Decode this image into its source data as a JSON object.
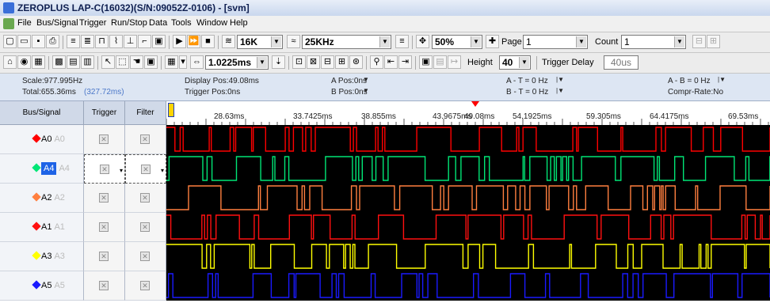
{
  "window": {
    "title": "ZEROPLUS LAP-C(16032)(S/N:09052Z-0106) - [svm]"
  },
  "menu": [
    "File",
    "Bus/Signal",
    "Trigger",
    "Run/Stop",
    "Data",
    "Tools",
    "Window",
    "Help"
  ],
  "toolbar1": {
    "memory_depth": "16K",
    "sample_rate": "25KHz",
    "zoom": "50%",
    "page_label": "Page",
    "page_value": "1",
    "count_label": "Count",
    "count_value": "1"
  },
  "toolbar2": {
    "time_per_div": "1.0225ms",
    "height_label": "Height",
    "height_value": "40",
    "trigger_delay_label": "Trigger Delay",
    "trigger_delay_value": "40us"
  },
  "info": {
    "scale": "Scale:977.995Hz",
    "total": "Total:655.36ms",
    "total_sub": "(327.72ms)",
    "display_pos": "Display Pos:49.08ms",
    "trigger_pos": "Trigger Pos:0ns",
    "a_pos": "A Pos:0ns",
    "b_pos": "B Pos:0ns",
    "a_minus_t": "A - T = 0 Hz",
    "b_minus_t": "B - T = 0 Hz",
    "a_minus_b": "A - B = 0 Hz",
    "compr_rate": "Compr-Rate:No"
  },
  "columns": {
    "bus_signal": "Bus/Signal",
    "trigger": "Trigger",
    "filter": "Filter"
  },
  "ruler": [
    "28.63ms",
    "33.7425ms",
    "38.855ms",
    "43.9675ms",
    "49.08ms",
    "54.1925ms",
    "59.305ms",
    "64.4175ms",
    "69.53ms"
  ],
  "signals": [
    {
      "name": "A0",
      "alias": "A0",
      "color": "#ff0000",
      "selected": false
    },
    {
      "name": "A4",
      "alias": "A4",
      "color": "#00e676",
      "selected": true
    },
    {
      "name": "A2",
      "alias": "A2",
      "color": "#ff7f3f",
      "selected": false
    },
    {
      "name": "A1",
      "alias": "A1",
      "color": "#ff1010",
      "selected": false
    },
    {
      "name": "A3",
      "alias": "A3",
      "color": "#ffff00",
      "selected": false
    },
    {
      "name": "A5",
      "alias": "A5",
      "color": "#1a1aff",
      "selected": false
    }
  ],
  "colors": {
    "trigger_marker": "#ff0000",
    "selection": "#1e63e6"
  }
}
